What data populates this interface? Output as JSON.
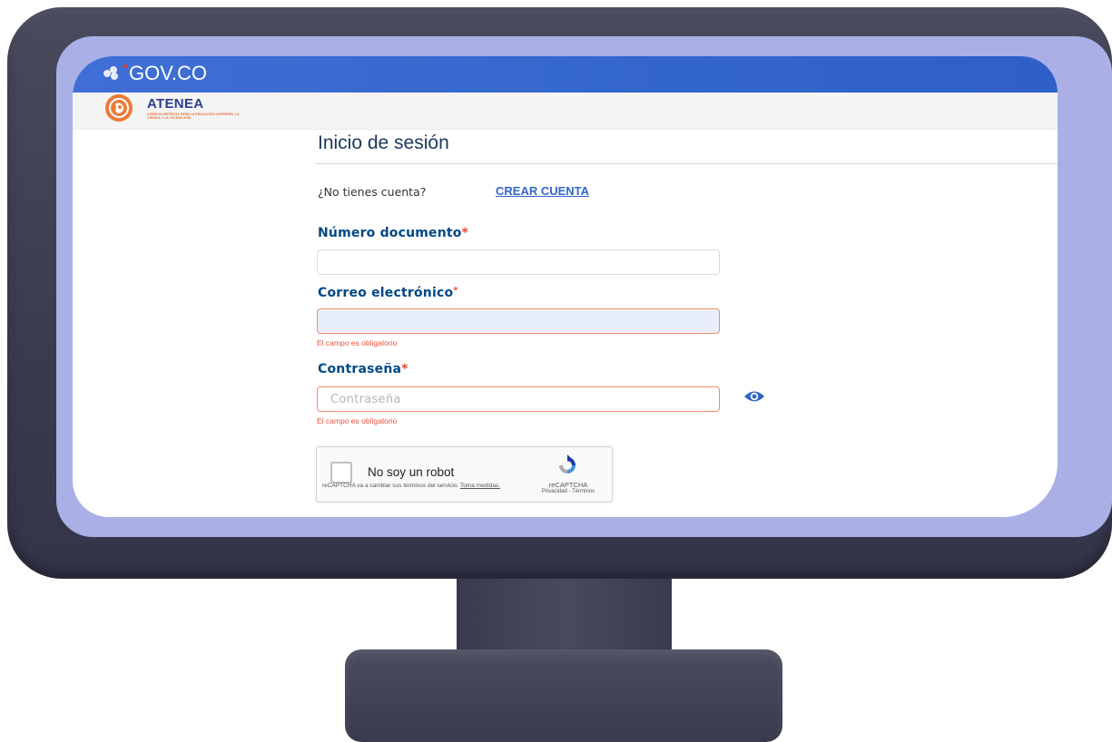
{
  "gov_bar": {
    "logo_text": "GOV.CO"
  },
  "brand": {
    "name": "ATENEA",
    "subtitle": "AGENCIA DISTRITAL PARA LA EDUCACIÓN SUPERIOR, LA CIENCIA Y LA TECNOLOGÍA"
  },
  "page": {
    "title": "Inicio de sesión",
    "no_account_text": "¿No tienes cuenta?",
    "create_account_link": "CREAR CUENTA"
  },
  "form": {
    "document": {
      "label": "Número documento",
      "required_mark": "*",
      "value": "",
      "placeholder": ""
    },
    "email": {
      "label": "Correo electrónico",
      "required_mark": "*",
      "value": "",
      "placeholder": "",
      "error": "El campo es obligatorio"
    },
    "password": {
      "label": "Contraseña",
      "required_mark": "*",
      "value": "",
      "placeholder": "Contraseña",
      "error": "El campo es obligatorio"
    }
  },
  "recaptcha": {
    "label": "No soy un robot",
    "notice": "reCAPTCHA va a cambiar sus términos del servicio.",
    "notice_link": "Toma medidas.",
    "brand": "reCAPTCHA",
    "privacy": "Privacidad",
    "separator": " - ",
    "terms": "Términos"
  },
  "colors": {
    "gov_blue": "#3366cc",
    "heading_blue": "#004884",
    "error_red": "#e8533c",
    "brand_orange": "#ec7a38",
    "bezel_lavender": "#aab0e6",
    "monitor_dark": "#3b3b4f"
  },
  "icons": {
    "show_password": "eye-icon",
    "gov_emblem": "gov-emblem-icon",
    "atenea_logo": "atenea-logo-icon",
    "recaptcha_logo": "recaptcha-logo-icon"
  }
}
